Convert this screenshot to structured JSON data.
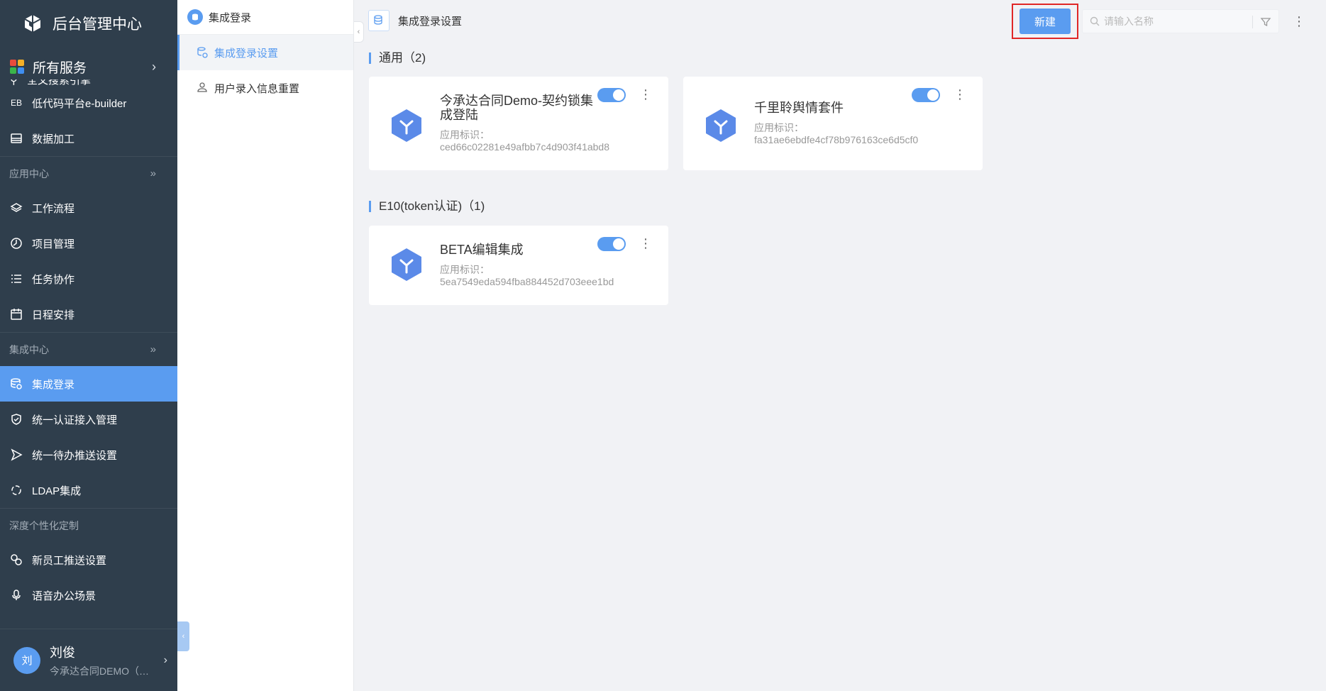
{
  "brand": {
    "title": "后台管理中心"
  },
  "sidebar": {
    "all_services": "所有服务",
    "partial_item": "全文搜索引擎",
    "items_top": [
      {
        "label": "低代码平台e-builder",
        "icon": "EB"
      },
      {
        "label": "数据加工",
        "icon": "data-icon"
      }
    ],
    "group_apps": "应用中心",
    "items_apps": [
      {
        "label": "工作流程",
        "icon": "layers-icon"
      },
      {
        "label": "项目管理",
        "icon": "project-icon"
      },
      {
        "label": "任务协作",
        "icon": "list-icon"
      },
      {
        "label": "日程安排",
        "icon": "calendar-icon"
      }
    ],
    "group_integration": "集成中心",
    "items_integration": [
      {
        "label": "集成登录",
        "icon": "db-icon",
        "active": true
      },
      {
        "label": "统一认证接入管理",
        "icon": "shield-icon"
      },
      {
        "label": "统一待办推送设置",
        "icon": "send-icon"
      },
      {
        "label": "LDAP集成",
        "icon": "sync-icon"
      }
    ],
    "group_custom": "深度个性化定制",
    "items_custom": [
      {
        "label": "新员工推送设置",
        "icon": "link-icon"
      },
      {
        "label": "语音办公场景",
        "icon": "mic-icon"
      }
    ],
    "user": {
      "avatar": "刘",
      "name": "刘俊",
      "org": "今承达合同DEMO（…"
    }
  },
  "submenu": {
    "header": "集成登录",
    "items": [
      {
        "label": "集成登录设置",
        "active": true
      },
      {
        "label": "用户录入信息重置",
        "active": false
      }
    ]
  },
  "page": {
    "title": "集成登录设置",
    "new_button": "新建",
    "search_placeholder": "请输入名称"
  },
  "sections": [
    {
      "title": "通用（2)",
      "cards": [
        {
          "name": "今承达合同Demo-契约锁集成登陆",
          "meta_label": "应用标识：",
          "meta_value": "ced66c02281e49afbb7c4d903f41abd8",
          "enabled": true
        },
        {
          "name": "千里聆舆情套件",
          "meta_label": "应用标识：",
          "meta_value": "fa31ae6ebdfe4cf78b976163ce6d5cf0",
          "enabled": true
        }
      ]
    },
    {
      "title": "E10(token认证)（1)",
      "cards": [
        {
          "name": "BETA编辑集成",
          "meta_label": "应用标识：",
          "meta_value": "5ea7549eda594fba884452d703eee1bd",
          "enabled": true
        }
      ]
    }
  ],
  "colors": {
    "sidebar_bg": "#2f3e4c",
    "accent": "#5a9cf0",
    "highlight_border": "#e02727"
  }
}
